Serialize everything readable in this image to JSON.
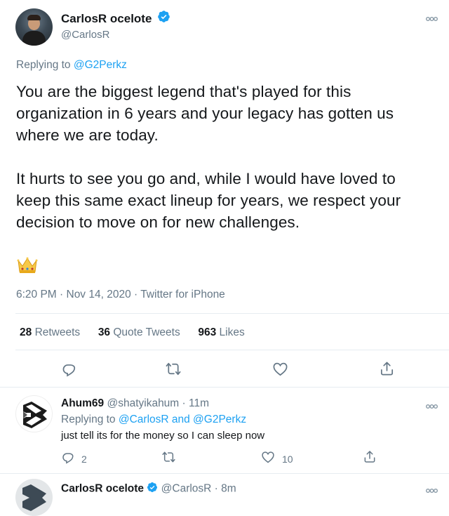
{
  "main_tweet": {
    "author_name": "CarlosR ocelote",
    "author_handle": "@CarlosR",
    "replying_to_prefix": "Replying to",
    "replying_to_handle": "@G2Perkz",
    "text_line_1": "You are the biggest legend that's played for this",
    "text_line_2": "organization in 6 years and your legacy has gotten us",
    "text_line_3": "where we are today.",
    "text_line_4": "It hurts to see you go and, while I would have loved to",
    "text_line_5": "keep this same exact lineup for years, we respect your",
    "text_line_6": "decision to move on for new challenges.",
    "emoji": "👑",
    "timestamp": "6:20 PM · Nov 14, 2020 · Twitter for iPhone",
    "retweets_count": "28",
    "retweets_label": "Retweets",
    "quote_count": "36",
    "quote_label": "Quote Tweets",
    "likes_count": "963",
    "likes_label": "Likes"
  },
  "reply": {
    "author_name": "Ahum69",
    "author_handle": "@shatyikahum",
    "time": "· 11m",
    "replying_to_prefix": "Replying to",
    "replying_to_handles": "@CarlosR and @G2Perkz",
    "text": "just tell its for the money so I can sleep now",
    "reply_count": "2",
    "like_count": "10"
  },
  "next_reply": {
    "author_name": "CarlosR ocelote",
    "author_handle": "@CarlosR",
    "time": "· 8m"
  },
  "icons": {
    "more": "more-options-icon",
    "reply": "reply-icon",
    "retweet": "retweet-icon",
    "like": "like-icon",
    "share": "share-icon",
    "verified": "verified-badge-icon"
  },
  "colors": {
    "accent": "#1da1f2",
    "muted": "#657786",
    "divider": "#e6ecf0",
    "text": "#14171a"
  }
}
